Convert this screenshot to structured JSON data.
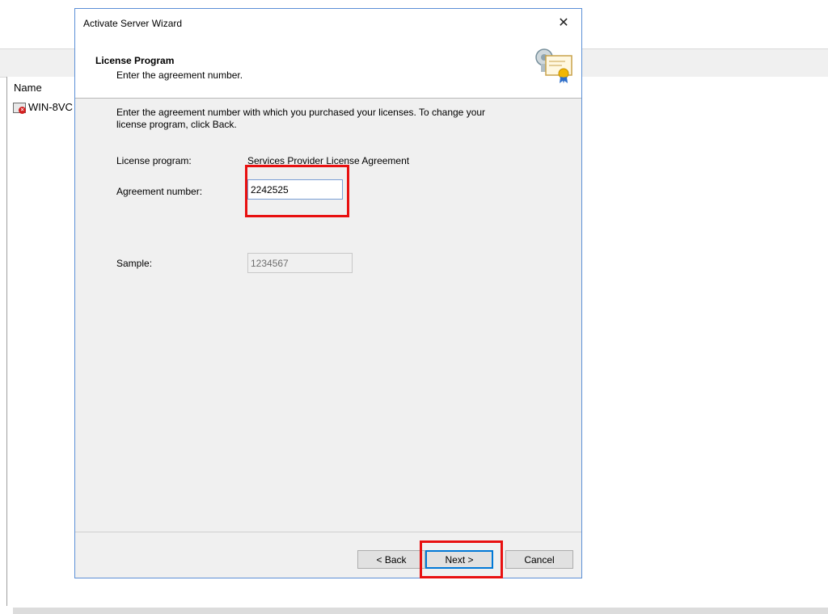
{
  "background": {
    "column_header": "Name",
    "server_row_label": "WIN-8VC"
  },
  "dialog": {
    "title": "Activate Server Wizard",
    "close_glyph": "✕",
    "header": {
      "title": "License Program",
      "subtitle": "Enter the agreement number."
    },
    "instructions": "Enter the agreement number with which you purchased your licenses. To change your license program, click Back.",
    "license_program_label": "License program:",
    "license_program_value": "Services Provider License Agreement",
    "agreement_number_label": "Agreement number:",
    "agreement_number_value": "2242525",
    "sample_label": "Sample:",
    "sample_value": "1234567",
    "buttons": {
      "back": "< Back",
      "next": "Next >",
      "cancel": "Cancel"
    }
  },
  "colors": {
    "highlight": "#e81010",
    "accent": "#0078d7"
  },
  "icons": {
    "close": "close-icon",
    "certificate": "certificate-icon",
    "server_error": "server-error-icon"
  }
}
